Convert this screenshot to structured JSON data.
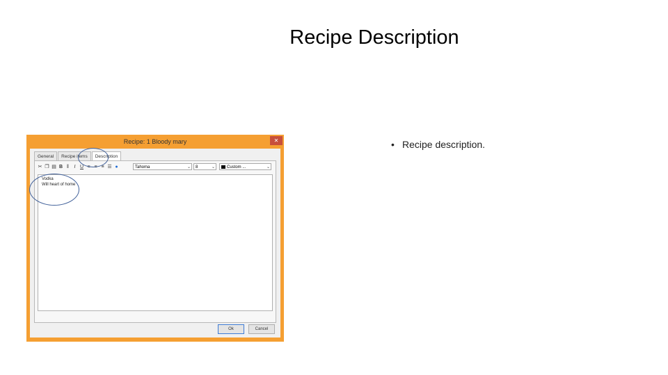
{
  "slide": {
    "title": "Recipe Description",
    "bullet": "Recipe description."
  },
  "dialog": {
    "title": "Recipe: 1 Bloody mary",
    "close_label": "✕",
    "tabs": [
      "General",
      "Recipe items",
      "Description"
    ],
    "active_tab": "Description",
    "font_value": "Tahoma",
    "size_value": "8",
    "color_value": "Custom ...",
    "editor_lines": [
      "Vodka",
      "Will heart of home"
    ],
    "ok_label": "Ok",
    "cancel_label": "Cancel"
  },
  "colors": {
    "window_frame": "#f59f32",
    "highlight_circle": "#3f5f99"
  }
}
